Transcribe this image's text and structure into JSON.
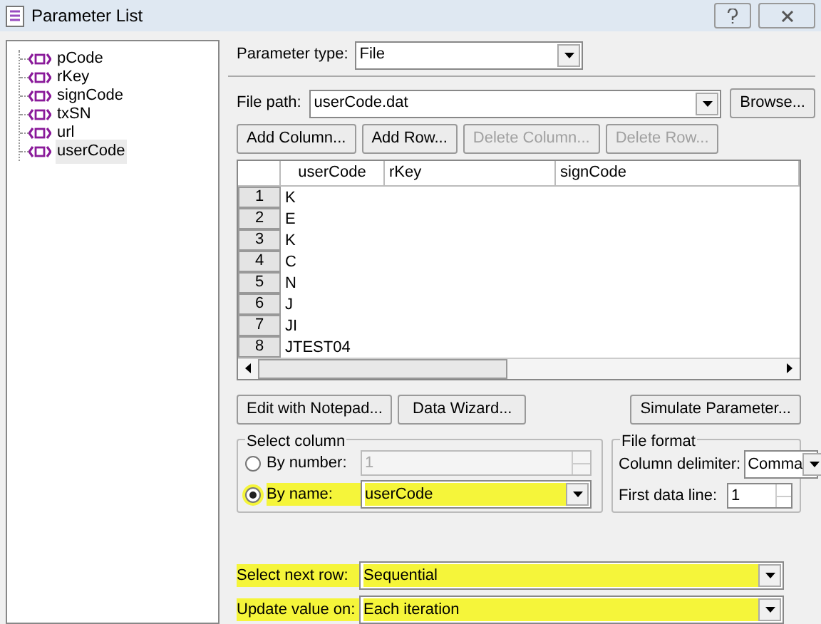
{
  "window": {
    "title": "Parameter List"
  },
  "tree": {
    "items": [
      {
        "label": "pCode",
        "selected": false
      },
      {
        "label": "rKey",
        "selected": false
      },
      {
        "label": "signCode",
        "selected": false
      },
      {
        "label": "txSN",
        "selected": false
      },
      {
        "label": "url",
        "selected": false
      },
      {
        "label": "userCode",
        "selected": true
      }
    ]
  },
  "parameter_type": {
    "label": "Parameter type:",
    "value": "File"
  },
  "file_path": {
    "label": "File path:",
    "value": "userCode.dat",
    "browse": "Browse..."
  },
  "toolbar": [
    {
      "label": "Add Column...",
      "disabled": false
    },
    {
      "label": "Add Row...",
      "disabled": false
    },
    {
      "label": "Delete Column...",
      "disabled": true
    },
    {
      "label": "Delete Row...",
      "disabled": true
    }
  ],
  "table": {
    "columns": [
      "userCode",
      "rKey",
      "signCode"
    ],
    "rows": [
      {
        "number": "1",
        "cells": [
          "K"
        ]
      },
      {
        "number": "2",
        "cells": [
          "E"
        ]
      },
      {
        "number": "3",
        "cells": [
          "K"
        ]
      },
      {
        "number": "4",
        "cells": [
          "C"
        ]
      },
      {
        "number": "5",
        "cells": [
          "N"
        ]
      },
      {
        "number": "6",
        "cells": [
          "J"
        ]
      },
      {
        "number": "7",
        "cells": [
          "JI"
        ]
      },
      {
        "number": "8",
        "cells": [
          "JTEST04"
        ]
      }
    ]
  },
  "left_actions": [
    "Edit with Notepad...",
    "Data Wizard..."
  ],
  "simulate": "Simulate Parameter...",
  "select_column": {
    "title": "Select column",
    "options": [
      {
        "label": "By number:",
        "selected": false,
        "value": "1",
        "kind": "spin",
        "highlighted": false
      },
      {
        "label": "By name:",
        "selected": true,
        "value": "userCode",
        "kind": "combo",
        "highlighted": true
      }
    ]
  },
  "file_format": {
    "title": "File format",
    "column_delimiter": {
      "label": "Column delimiter:",
      "value": "Comma"
    },
    "first_data_line": {
      "label": "First data line:",
      "value": "1"
    }
  },
  "select_next_row": {
    "label": "Select next row:",
    "value": "Sequential",
    "highlighted": true
  },
  "update_value_on": {
    "label": "Update value on:",
    "value": "Each iteration",
    "highlighted": true
  }
}
